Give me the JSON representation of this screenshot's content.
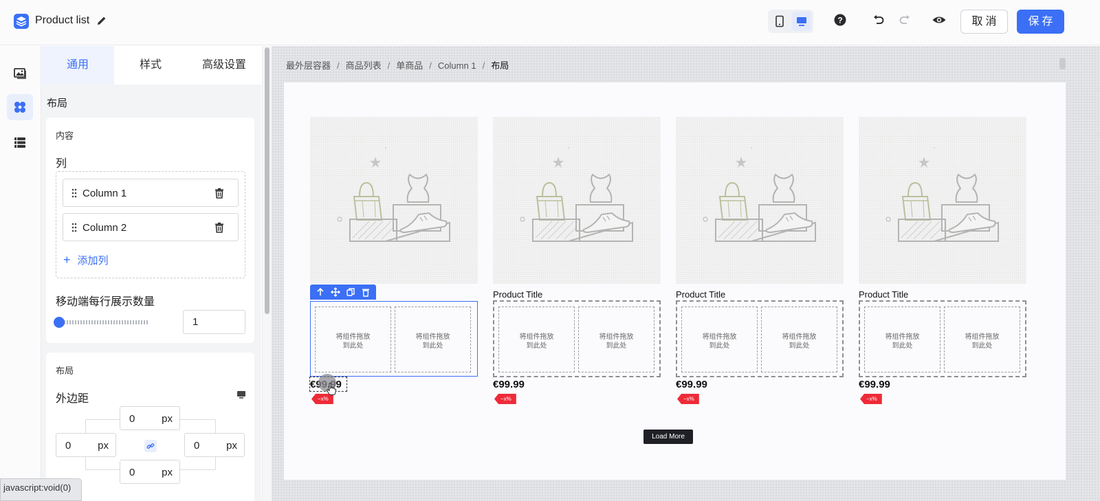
{
  "header": {
    "title": "Product list",
    "cancel_label": "取消",
    "save_label": "保存",
    "icons": {
      "logo": "layers-icon",
      "edit": "pencil-icon",
      "mobile": "mobile-icon",
      "desktop": "desktop-icon",
      "help": "help-icon",
      "undo": "undo-icon",
      "redo": "redo-icon",
      "preview": "eye-icon"
    },
    "accent_color": "#3b6ff5"
  },
  "rail": {
    "items": [
      {
        "name": "media",
        "icon": "image-icon"
      },
      {
        "name": "components",
        "icon": "components-icon",
        "active": true
      },
      {
        "name": "layers",
        "icon": "sections-icon"
      }
    ]
  },
  "panel": {
    "tabs": [
      {
        "label": "通用",
        "active": true
      },
      {
        "label": "样式",
        "active": false
      },
      {
        "label": "高级设置",
        "active": false
      }
    ],
    "section_title": "布局",
    "content_card": {
      "title": "内容",
      "columns_label": "列",
      "columns": [
        "Column 1",
        "Column 2"
      ],
      "add_column_label": "添加列",
      "mobile_per_row_label": "移动端每行展示数量",
      "mobile_per_row_value": "1"
    },
    "layout_card": {
      "title": "布局",
      "margin_label": "外边距",
      "margin": {
        "top": "0",
        "left": "0",
        "right": "0",
        "bottom": "0",
        "unit": "px"
      }
    }
  },
  "canvas": {
    "breadcrumb": [
      "最外层容器",
      "商品列表",
      "单商品",
      "Column 1",
      "布局"
    ],
    "products": [
      {
        "title": "",
        "price": "€99.99",
        "badge": "−x%",
        "selected": true
      },
      {
        "title": "Product Title",
        "price": "€99.99",
        "badge": "−x%",
        "selected": false
      },
      {
        "title": "Product Title",
        "price": "€99.99",
        "badge": "−x%",
        "selected": false
      },
      {
        "title": "Product Title",
        "price": "€99.99",
        "badge": "−x%",
        "selected": false
      }
    ],
    "dropzone_text": "将组件拖放到此处",
    "load_more_label": "Load More"
  },
  "status_bar": {
    "text": "javascript:void(0)"
  }
}
